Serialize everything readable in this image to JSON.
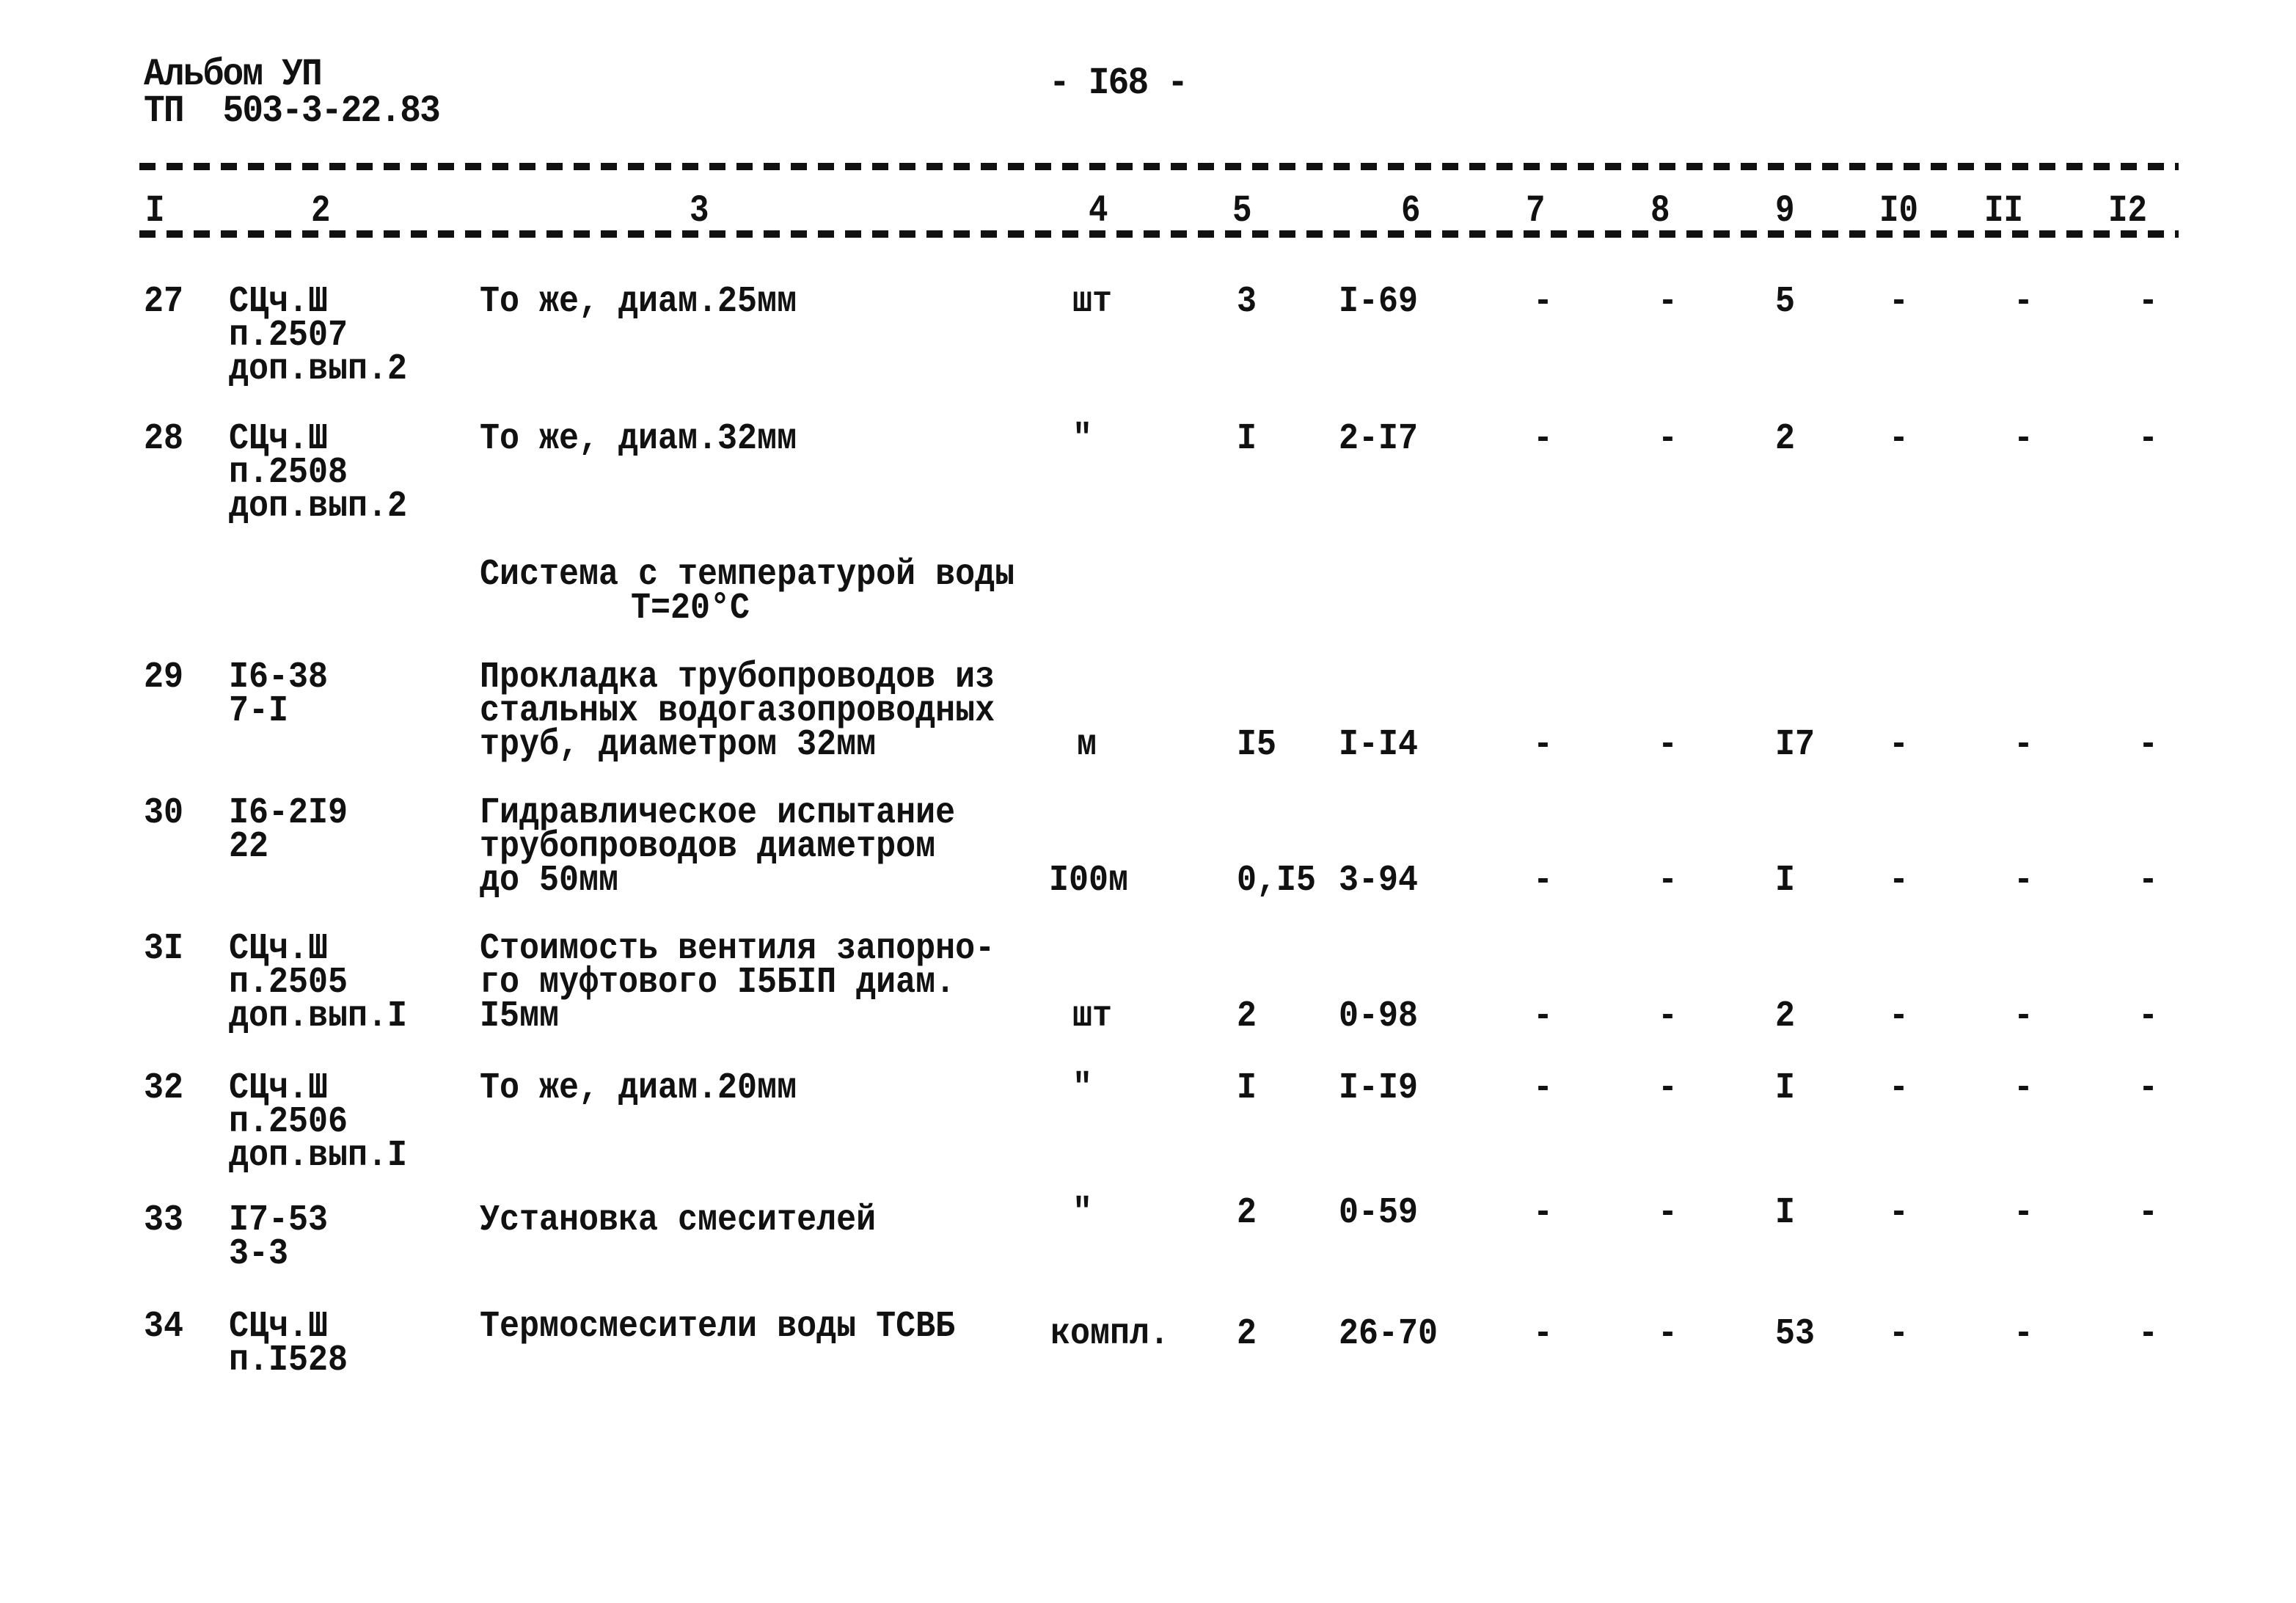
{
  "header": {
    "album_line": "Альбом УП",
    "project_line": "ТП  503-3-22.83",
    "page_number": "- I68 -"
  },
  "columns": [
    "I",
    "2",
    "3",
    "4",
    "5",
    "6",
    "7",
    "8",
    "9",
    "I0",
    "II",
    "I2"
  ],
  "section": {
    "line1": "Система с температурой воды",
    "line2": "Т=20°С"
  },
  "rows": [
    {
      "num": "27",
      "code": [
        "СЦч.Ш",
        "п.2507",
        "доп.вып.2"
      ],
      "desc": [
        "То же, диам.25мм"
      ],
      "unit": "шт",
      "qty": "3",
      "price": "I-69",
      "c7": "-",
      "c8": "-",
      "c9": "5",
      "c10": "-",
      "c11": "-",
      "c12": "-"
    },
    {
      "num": "28",
      "code": [
        "СЦч.Ш",
        "п.2508",
        "доп.вып.2"
      ],
      "desc": [
        "То же, диам.32мм"
      ],
      "unit": "\"",
      "qty": "I",
      "price": "2-I7",
      "c7": "-",
      "c8": "-",
      "c9": "2",
      "c10": "-",
      "c11": "-",
      "c12": "-"
    },
    {
      "num": "29",
      "code": [
        "I6-38",
        "7-I"
      ],
      "desc": [
        "Прокладка трубопроводов из",
        "стальных водогазопроводных",
        "труб, диаметром 32мм"
      ],
      "unit": "м",
      "qty": "I5",
      "price": "I-I4",
      "c7": "-",
      "c8": "-",
      "c9": "I7",
      "c10": "-",
      "c11": "-",
      "c12": "-"
    },
    {
      "num": "30",
      "code": [
        "I6-2I9",
        "22"
      ],
      "desc": [
        "Гидравлическое испытание",
        "трубопроводов диаметром",
        "до 50мм"
      ],
      "unit": "I00м",
      "qty": "0,I5",
      "price": "3-94",
      "c7": "-",
      "c8": "-",
      "c9": "I",
      "c10": "-",
      "c11": "-",
      "c12": "-"
    },
    {
      "num": "3I",
      "code": [
        "СЦч.Ш",
        "п.2505",
        "доп.вып.I"
      ],
      "desc": [
        "Стоимость вентиля запорно-",
        "го муфтового I5БIП диам.",
        "I5мм"
      ],
      "unit": "шт",
      "qty": "2",
      "price": "0-98",
      "c7": "-",
      "c8": "-",
      "c9": "2",
      "c10": "-",
      "c11": "-",
      "c12": "-"
    },
    {
      "num": "32",
      "code": [
        "СЦч.Ш",
        "п.2506",
        "доп.вып.I"
      ],
      "desc": [
        "То же, диам.20мм"
      ],
      "unit": "\"",
      "qty": "I",
      "price": "I-I9",
      "c7": "-",
      "c8": "-",
      "c9": "I",
      "c10": "-",
      "c11": "-",
      "c12": "-"
    },
    {
      "num": "33",
      "code": [
        "I7-53",
        "3-3"
      ],
      "desc": [
        "Установка смесителей"
      ],
      "unit": "\"",
      "qty": "2",
      "price": "0-59",
      "c7": "-",
      "c8": "-",
      "c9": "I",
      "c10": "-",
      "c11": "-",
      "c12": "-"
    },
    {
      "num": "34",
      "code": [
        "СЦч.Ш",
        "п.I528"
      ],
      "desc": [
        "Термосмесители воды ТСВБ"
      ],
      "unit": "компл.",
      "qty": "2",
      "price": "26-70",
      "c7": "-",
      "c8": "-",
      "c9": "53",
      "c10": "-",
      "c11": "-",
      "c12": "-"
    }
  ]
}
